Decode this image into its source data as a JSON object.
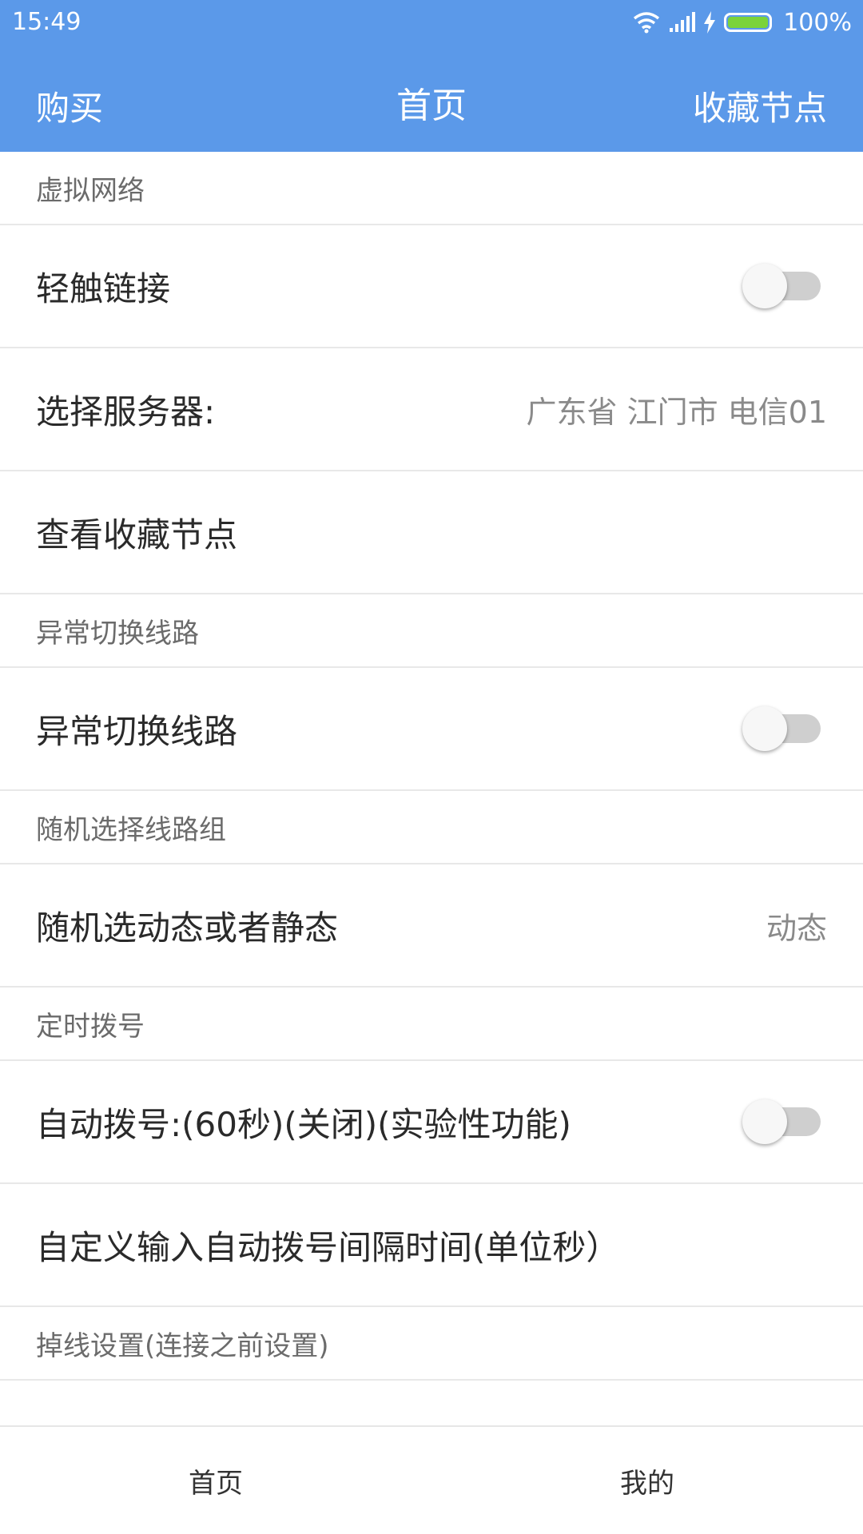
{
  "status_bar": {
    "time": "15:49",
    "battery_text": "100%",
    "battery_level": 1.0,
    "icons": [
      "wifi-icon",
      "signal-icon",
      "charging-icon",
      "battery-icon"
    ]
  },
  "header": {
    "left_label": "购买",
    "title": "首页",
    "right_label": "收藏节点",
    "background_color": "#5b99e9"
  },
  "sections": {
    "virtual_network": {
      "header": "虚拟网络",
      "touch_connect_label": "轻触链接",
      "touch_connect_on": false,
      "select_server_label": "选择服务器:",
      "select_server_value": "广东省 江门市 电信01",
      "view_favorites_label": "查看收藏节点"
    },
    "failover": {
      "header": "异常切换线路",
      "failover_label": "异常切换线路",
      "failover_on": false
    },
    "random_group": {
      "header": "随机选择线路组",
      "random_label": "随机选动态或者静态",
      "random_value": "动态"
    },
    "timed_dial": {
      "header": "定时拨号",
      "auto_dial_label": "自动拨号:(60秒)(关闭)(实验性功能)",
      "auto_dial_on": false,
      "custom_interval_label": "自定义输入自动拨号间隔时间(单位秒）"
    },
    "disconnect": {
      "header": "掉线设置(连接之前设置)"
    }
  },
  "bottom_nav": {
    "home_label": "首页",
    "mine_label": "我的"
  }
}
